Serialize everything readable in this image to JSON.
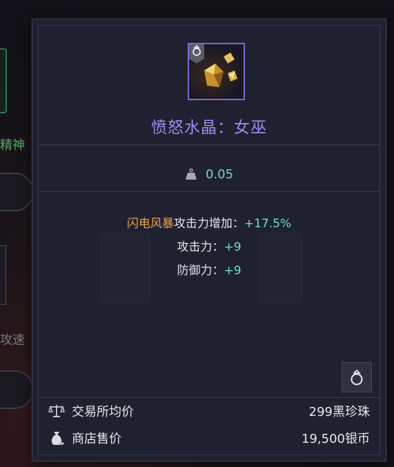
{
  "background": {
    "label_spirit": "精神",
    "label_attack_speed": "攻速"
  },
  "item": {
    "icon": "golden-crystal-icon",
    "badge_icon": "ring-icon",
    "name": "愤怒水晶：女巫",
    "name_color": "#9a8ff0",
    "weight_icon": "weight-icon",
    "weight": "0.05"
  },
  "stats": [
    {
      "skill": "闪电风暴",
      "label": "攻击力增加：",
      "value": "+17.5%"
    },
    {
      "skill": "",
      "label": "攻击力：",
      "value": "+9"
    },
    {
      "skill": "",
      "label": "防御力：",
      "value": "+9"
    }
  ],
  "bag_button_icon": "ring-icon",
  "prices": {
    "market": {
      "icon": "scales-icon",
      "label": "交易所均价",
      "value": "299黑珍珠"
    },
    "shop": {
      "icon": "money-bag-icon",
      "label": "商店售价",
      "value": "19,500银币"
    }
  },
  "colors": {
    "skill": "#f0a050",
    "stat_value": "#6fe0c8",
    "tooltip_bg": "#1f2130"
  }
}
